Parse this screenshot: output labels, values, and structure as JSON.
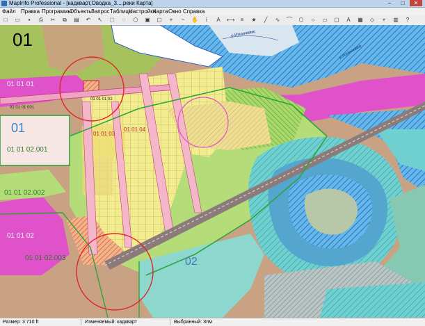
{
  "window": {
    "title": "MapInfo Professional - [кадкварт,Оводка_3....реки Карта]",
    "buttons": [
      "–",
      "□",
      "✕"
    ]
  },
  "menu": [
    "Файл",
    "Правка",
    "Программы",
    "Объекты",
    "Запрос",
    "Таблицы",
    "Настройки",
    "Карта",
    "Окно",
    "Справка"
  ],
  "toolbar": {
    "icons": [
      "new-icon",
      "open-icon",
      "save-icon",
      "print-icon",
      "cut-icon",
      "copy-icon",
      "paste-icon",
      "undo-icon",
      "select-icon",
      "marquee-icon",
      "radius-icon",
      "polygon-select-icon",
      "boundary-select-icon",
      "unselect-icon",
      "zoom-in-icon",
      "zoom-out-icon",
      "pan-icon",
      "info-icon",
      "label-icon",
      "ruler-icon",
      "layer-control-icon",
      "symbol-icon",
      "line-icon",
      "polyline-icon",
      "arc-icon",
      "polygon-icon",
      "ellipse-icon",
      "rectangle-icon",
      "rounded-rect-icon",
      "text-icon",
      "frame-icon",
      "reshape-icon",
      "add-node-icon",
      "legend-icon",
      "help-icon"
    ]
  },
  "map": {
    "labels": {
      "zone01": "01",
      "zone01_01_01": "01 01 01",
      "zone01_01_01_001": "01 01 01 001",
      "zone01_01_01_02": "01 01 01 02",
      "zone01_01_03": "01 01 03",
      "zone01_01_04": "01 01 04",
      "zone01_left": "01",
      "zone01_01_02_001": "01 01 02.001",
      "zone01_01_02_002": "01 01 02.002",
      "zone01_01_02": "01 01 02",
      "zone01_01_02_003": "01 01 02.003",
      "zone02": "02",
      "river1": "р.Изнинкамо",
      "river2": "р.Изнинкамо"
    }
  },
  "status": {
    "size": "Размер: 3 710 ft",
    "edited": "Изменяемый: кадкварт",
    "selected": "Выбранный: Зпм"
  }
}
